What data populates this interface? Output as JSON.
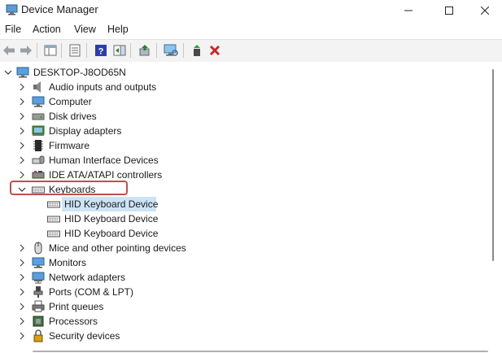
{
  "window": {
    "title": "Device Manager"
  },
  "menu": [
    "File",
    "Action",
    "View",
    "Help"
  ],
  "toolbar": {
    "buttons": [
      "back-arrow-icon",
      "forward-arrow-icon",
      "properties-pane-icon",
      "properties-sheet-icon",
      "help-icon",
      "action-pane-icon",
      "update-driver-icon",
      "scan-hardware-icon",
      "enable-device-icon",
      "uninstall-device-icon"
    ]
  },
  "tree": {
    "root": "DESKTOP-J8OD65N",
    "categories": [
      {
        "label": "Audio inputs and outputs",
        "icon": "speaker-icon"
      },
      {
        "label": "Computer",
        "icon": "monitor-icon"
      },
      {
        "label": "Disk drives",
        "icon": "disk-icon"
      },
      {
        "label": "Display adapters",
        "icon": "display-adapter-icon"
      },
      {
        "label": "Firmware",
        "icon": "chip-icon"
      },
      {
        "label": "Human Interface Devices",
        "icon": "hid-icon"
      },
      {
        "label": "IDE ATA/ATAPI controllers",
        "icon": "ide-controller-icon"
      },
      {
        "label": "Keyboards",
        "icon": "keyboard-icon"
      },
      {
        "label": "Mice and other pointing devices",
        "icon": "mouse-icon"
      },
      {
        "label": "Monitors",
        "icon": "monitor-icon"
      },
      {
        "label": "Network adapters",
        "icon": "network-icon"
      },
      {
        "label": "Ports (COM & LPT)",
        "icon": "port-icon"
      },
      {
        "label": "Print queues",
        "icon": "printer-icon"
      },
      {
        "label": "Processors",
        "icon": "processor-icon"
      },
      {
        "label": "Security devices",
        "icon": "security-icon"
      }
    ],
    "keyboard_children": [
      "HID Keyboard Device",
      "HID Keyboard Device",
      "HID Keyboard Device"
    ]
  },
  "colors": {
    "selection": "#cce4f7",
    "highlight_box": "#c0504d",
    "toolbar_bg": "#f3f3f3"
  }
}
